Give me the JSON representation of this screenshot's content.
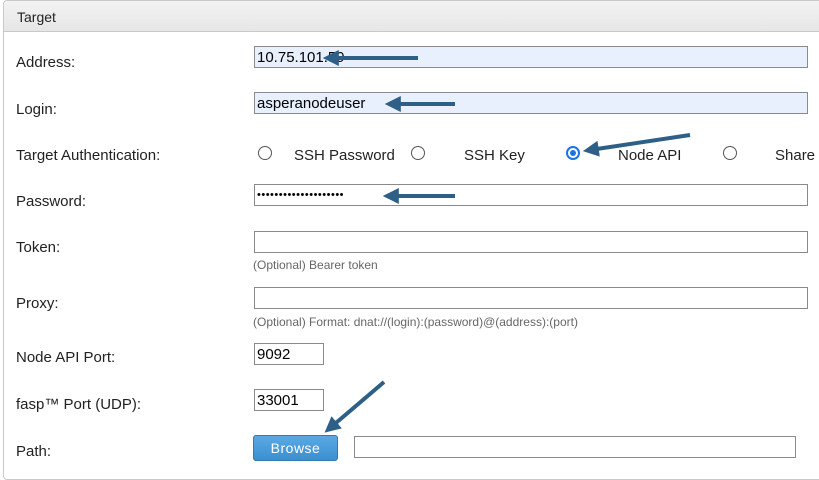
{
  "panel": {
    "title": "Target"
  },
  "form": {
    "address": {
      "label": "Address:",
      "value": "10.75.101.59"
    },
    "login": {
      "label": "Login:",
      "value": "asperanodeuser"
    },
    "target_auth": {
      "label": "Target Authentication:",
      "options": [
        "SSH Password",
        "SSH Key",
        "Node API",
        "Share"
      ],
      "selected": "Node API"
    },
    "password": {
      "label": "Password:",
      "value": "••••••••••••••••••••"
    },
    "token": {
      "label": "Token:",
      "value": "",
      "hint": "(Optional) Bearer token"
    },
    "proxy": {
      "label": "Proxy:",
      "value": "",
      "hint": "(Optional) Format: dnat://(login):(password)@(address):(port)"
    },
    "node_api_port": {
      "label": "Node API Port:",
      "value": "9092"
    },
    "fasp_port": {
      "label": "fasp™ Port (UDP):",
      "value": "33001"
    },
    "path": {
      "label": "Path:",
      "browse_label": "Browse",
      "value": ""
    }
  },
  "colors": {
    "arrow": "#2e5f87",
    "accent": "#1a73e8",
    "button": "#4a9cdb",
    "autofill": "#e8f0fe"
  }
}
